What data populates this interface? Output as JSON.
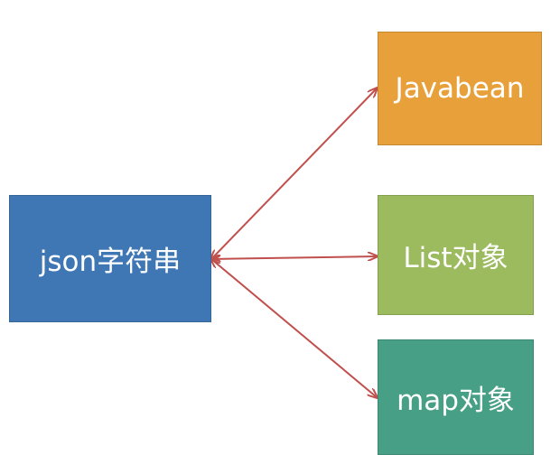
{
  "diagram": {
    "source": {
      "label": "json字符串"
    },
    "targets": [
      {
        "label": "Javabean"
      },
      {
        "label": "List对象"
      },
      {
        "label": "map对象"
      }
    ]
  },
  "colors": {
    "source_box": "#3f77b4",
    "javabean_box": "#e8a03a",
    "list_box": "#9bbb5e",
    "map_box": "#479f85",
    "arrow": "#c0504d",
    "text": "#ffffff"
  }
}
